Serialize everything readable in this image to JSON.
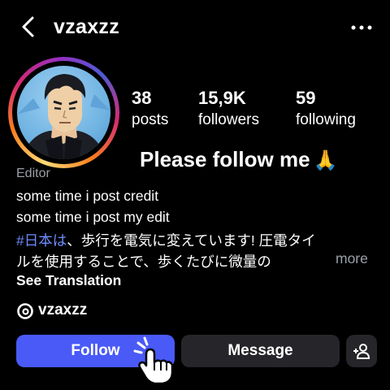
{
  "header": {
    "username": "vzaxzz",
    "back_icon": "chevron-left-icon",
    "menu_icon": "more-horizontal-icon"
  },
  "profile": {
    "avatar_icon": "anime-character-avatar",
    "stats": [
      {
        "value": "38",
        "label": "posts"
      },
      {
        "value": "15,9K",
        "label": "followers"
      },
      {
        "value": "59",
        "label": "following"
      }
    ]
  },
  "overlay": {
    "caption": "Please follow me",
    "emoji": "🙏"
  },
  "bio": {
    "category": "Editor",
    "line1": "some time i post credit",
    "line2": "some time i post my edit",
    "hashtag": "#日本は",
    "line3_rest": "、歩行を電気に変えています! 圧電タイ",
    "line4": "ルを使用することで、歩くたびに微量の",
    "more_label": "more",
    "see_translation": "See Translation"
  },
  "threads": {
    "icon": "threads-icon",
    "handle": "vzaxzz"
  },
  "actions": {
    "follow_label": "Follow",
    "message_label": "Message",
    "add_person_icon": "add-person-icon",
    "cursor_icon": "pointing-hand-cursor-icon"
  },
  "colors": {
    "background": "#000000",
    "follow_button": "#4a5af7",
    "secondary_button": "#26262a",
    "hashtag": "#6f8cff",
    "muted_text": "#9aa0a6"
  }
}
